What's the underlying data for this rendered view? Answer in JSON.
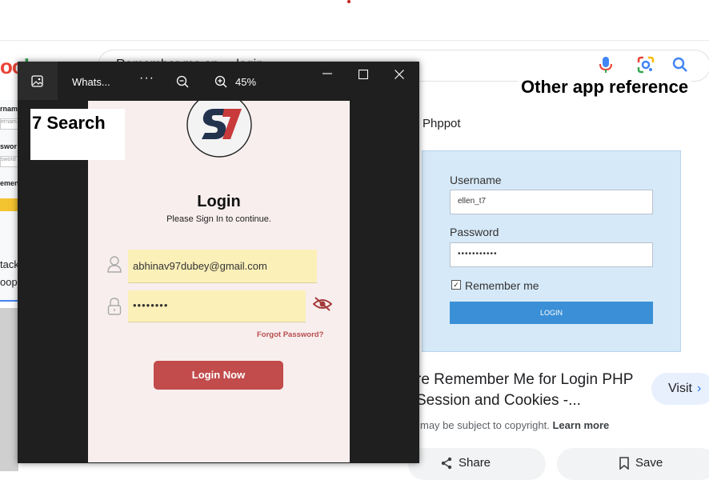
{
  "browser": {
    "search_query": "Remember me on ... login",
    "logo_fragment_a": "oo",
    "logo_fragment_b": "l"
  },
  "overlay_note": "Other app reference",
  "left_strip": {
    "labels": [
      "rnam",
      "ernam",
      "swor",
      "sword",
      "emen",
      "tack",
      "oop"
    ]
  },
  "result": {
    "source": "Phppot",
    "title": "re Remember Me for Login PHP Session and Cookies -...",
    "visit_label": "Visit",
    "copyright_text": "may be subject to copyright.",
    "learn_more": "Learn more",
    "share_label": "Share",
    "save_label": "Save",
    "reference_image": {
      "username_label": "Username",
      "username_value": "ellen_t7",
      "password_label": "Password",
      "password_value": "•••••••••••",
      "remember_label": "Remember me",
      "login_label": "LOGIN"
    }
  },
  "viewer": {
    "title": "Whats...",
    "more": "···",
    "zoom": "45%",
    "app_screen": {
      "heading": "Login",
      "subheading": "Please Sign In to continue.",
      "email_value": "abhinav97dubey@gmail.com",
      "password_value": "••••••••",
      "forgot_label": "Forgot Password?",
      "login_button": "Login Now"
    }
  },
  "sticker": "7 Search",
  "colors": {
    "accent_red": "#c24b4b",
    "field_yellow": "#fbf0b8",
    "ref_blue": "#3a8fd6"
  }
}
